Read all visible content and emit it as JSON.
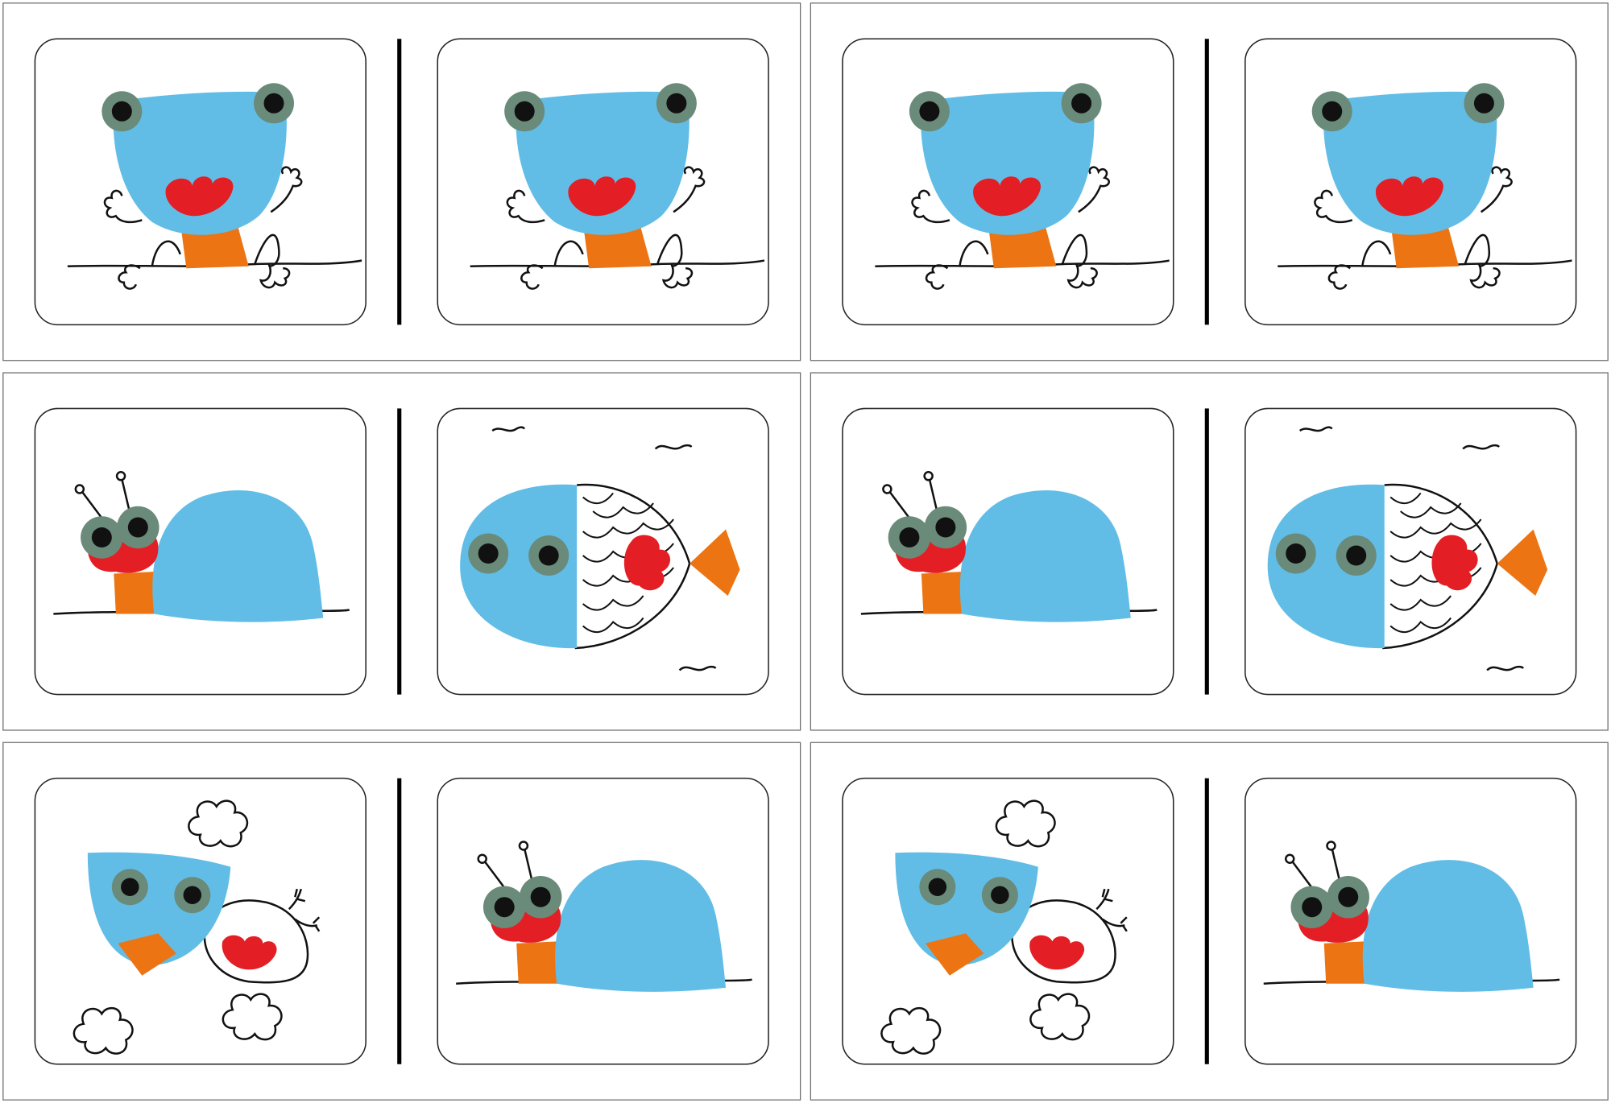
{
  "title": "",
  "colors": {
    "blue": "#62bde6",
    "green_grey": "#6a8a7a",
    "red": "#e31e24",
    "orange": "#ec7413",
    "ink": "#111111",
    "frame": "#6e6e6e",
    "card_border": "#222222"
  },
  "layout": {
    "rows": 3,
    "columns": 2
  },
  "dominoes": [
    {
      "left": "frog",
      "right": "frog"
    },
    {
      "left": "frog",
      "right": "frog"
    },
    {
      "left": "snail",
      "right": "fish"
    },
    {
      "left": "snail",
      "right": "fish"
    },
    {
      "left": "bird",
      "right": "snail"
    },
    {
      "left": "bird",
      "right": "snail"
    }
  ]
}
